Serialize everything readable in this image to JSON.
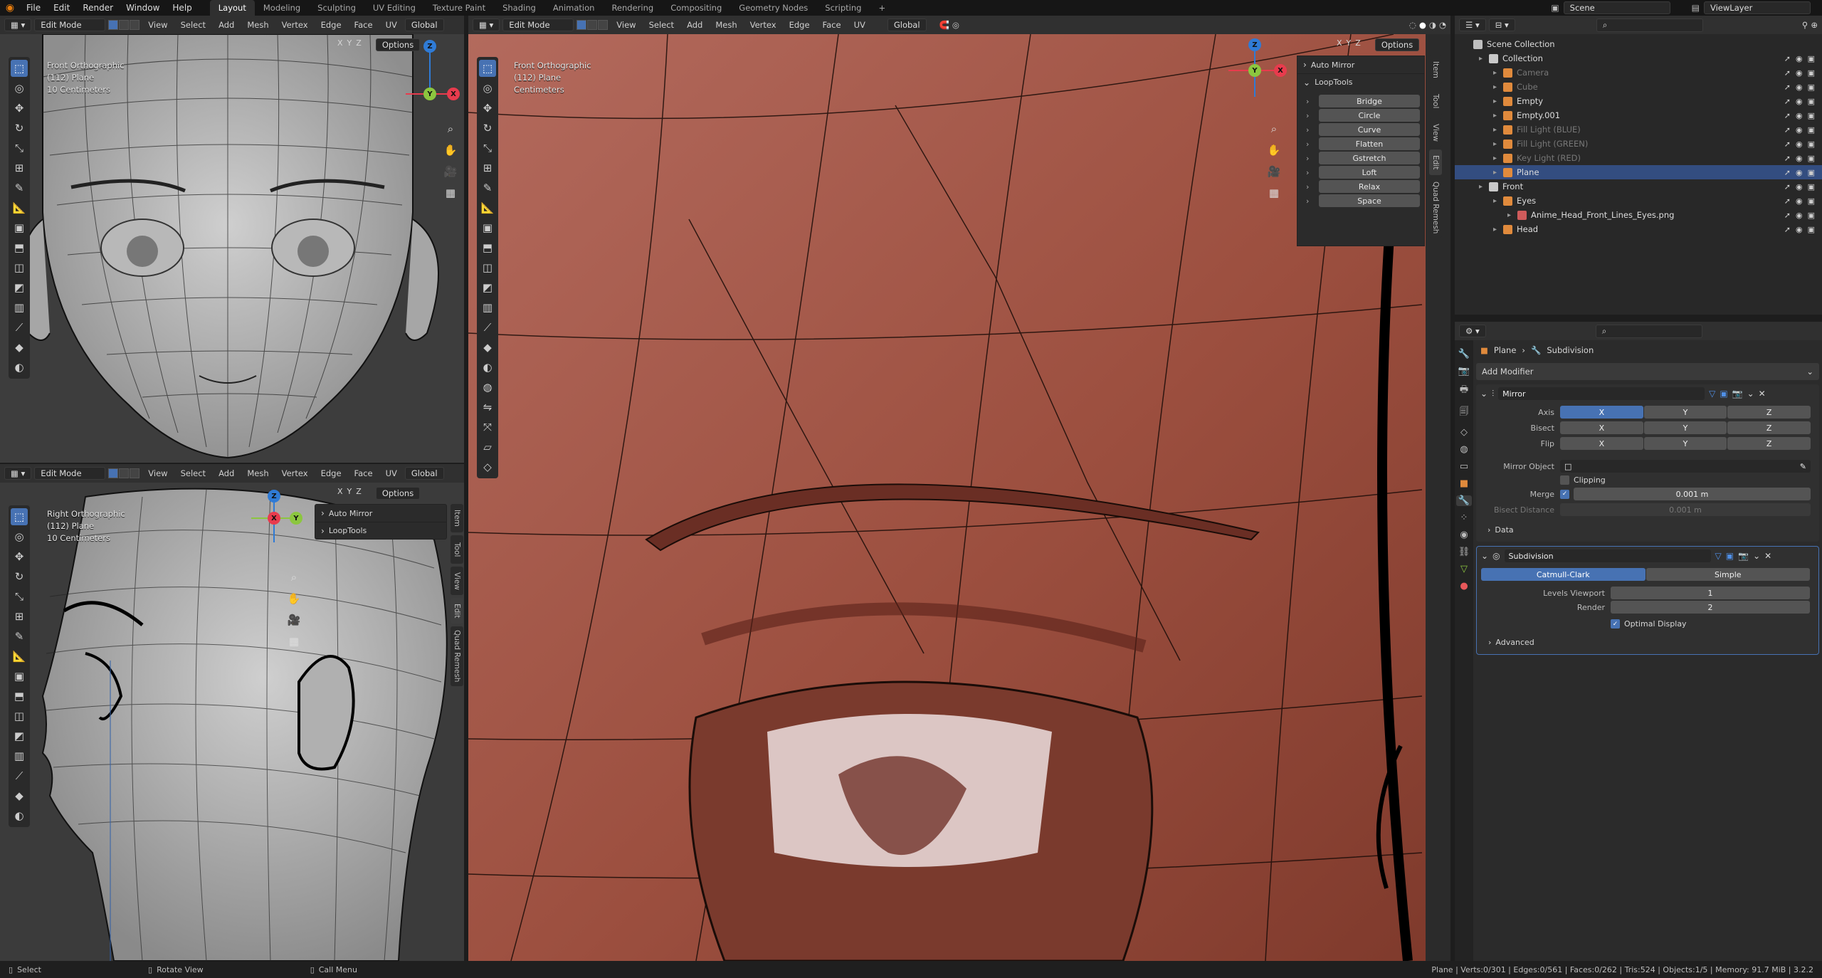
{
  "topbar": {
    "menus": [
      "File",
      "Edit",
      "Render",
      "Window",
      "Help"
    ],
    "workspaces": [
      "Layout",
      "Modeling",
      "Sculpting",
      "UV Editing",
      "Texture Paint",
      "Shading",
      "Animation",
      "Rendering",
      "Compositing",
      "Geometry Nodes",
      "Scripting"
    ],
    "active_workspace": "Layout",
    "add_tab": "+",
    "scene_label": "Scene",
    "viewlayer_label": "ViewLayer"
  },
  "vp_header": {
    "mode": "Edit Mode",
    "menus": [
      "View",
      "Select",
      "Add",
      "Mesh",
      "Vertex",
      "Edge",
      "Face",
      "UV"
    ],
    "orientation": "Global",
    "options": "Options",
    "axes": [
      "X",
      "Y",
      "Z"
    ]
  },
  "vp_front": {
    "view_name": "Front Orthographic",
    "object": "(112) Plane",
    "scale": "10 Centimeters"
  },
  "vp_right": {
    "view_name": "Right Orthographic",
    "object": "(112) Plane",
    "scale": "10 Centimeters",
    "panels": [
      "Auto Mirror",
      "LoopTools"
    ]
  },
  "vp_main": {
    "view_name": "Front Orthographic",
    "object": "(112) Plane",
    "scale": "Centimeters",
    "auto_mirror": "Auto Mirror",
    "looptools_title": "LoopTools",
    "looptools_buttons": [
      "Bridge",
      "Circle",
      "Curve",
      "Flatten",
      "Gstretch",
      "Loft",
      "Relax",
      "Space"
    ]
  },
  "side_tabs": [
    "Item",
    "Tool",
    "View",
    "Edit",
    "Quad Remesh"
  ],
  "gizmo": {
    "x": "X",
    "y": "Y",
    "z": "Z"
  },
  "outliner": {
    "title": "Scene Collection",
    "rows": [
      {
        "label": "Collection",
        "indent": 1,
        "dim": false,
        "color": "#c9c9c9"
      },
      {
        "label": "Camera",
        "indent": 2,
        "dim": true,
        "color": "#e08a3c"
      },
      {
        "label": "Cube",
        "indent": 2,
        "dim": true,
        "color": "#e08a3c"
      },
      {
        "label": "Empty",
        "indent": 2,
        "dim": false,
        "color": "#e08a3c"
      },
      {
        "label": "Empty.001",
        "indent": 2,
        "dim": false,
        "color": "#e08a3c"
      },
      {
        "label": "Fill Light (BLUE)",
        "indent": 2,
        "dim": true,
        "color": "#e08a3c"
      },
      {
        "label": "Fill Light (GREEN)",
        "indent": 2,
        "dim": true,
        "color": "#e08a3c"
      },
      {
        "label": "Key Light (RED)",
        "indent": 2,
        "dim": true,
        "color": "#e08a3c"
      },
      {
        "label": "Plane",
        "indent": 2,
        "dim": false,
        "color": "#e08a3c",
        "selected": true
      },
      {
        "label": "Front",
        "indent": 1,
        "dim": false,
        "color": "#c9c9c9"
      },
      {
        "label": "Eyes",
        "indent": 2,
        "dim": false,
        "color": "#e08a3c"
      },
      {
        "label": "Anime_Head_Front_Lines_Eyes.png",
        "indent": 3,
        "dim": false,
        "color": "#cf5b5b"
      },
      {
        "label": "Head",
        "indent": 2,
        "dim": false,
        "color": "#e08a3c"
      }
    ]
  },
  "properties": {
    "breadcrumb_object": "Plane",
    "breadcrumb_modifier": "Subdivision",
    "add_modifier": "Add Modifier",
    "mirror": {
      "name": "Mirror",
      "axis_label": "Axis",
      "bisect_label": "Bisect",
      "flip_label": "Flip",
      "axes": [
        "X",
        "Y",
        "Z"
      ],
      "mirror_object_label": "Mirror Object",
      "clipping_label": "Clipping",
      "merge_label": "Merge",
      "merge_value": "0.001 m",
      "bisect_distance_label": "Bisect Distance",
      "bisect_distance_value": "0.001 m",
      "data_label": "Data"
    },
    "subdivision": {
      "name": "Subdivision",
      "type_catmull": "Catmull-Clark",
      "type_simple": "Simple",
      "levels_viewport_label": "Levels Viewport",
      "levels_viewport": "1",
      "render_label": "Render",
      "render": "2",
      "optimal_display": "Optimal Display",
      "advanced": "Advanced"
    }
  },
  "status": {
    "select": "Select",
    "rotate": "Rotate View",
    "call_menu": "Call Menu",
    "stats": "Plane | Verts:0/301 | Edges:0/561 | Faces:0/262 | Tris:524 | Objects:1/5 | Memory: 91.7 MiB | 3.2.2"
  },
  "colors": {
    "accent": "#4772b3",
    "skin": "#a35a4c",
    "x_axis": "#e83b4d",
    "y_axis": "#8cc63f",
    "z_axis": "#2f7bd6"
  }
}
